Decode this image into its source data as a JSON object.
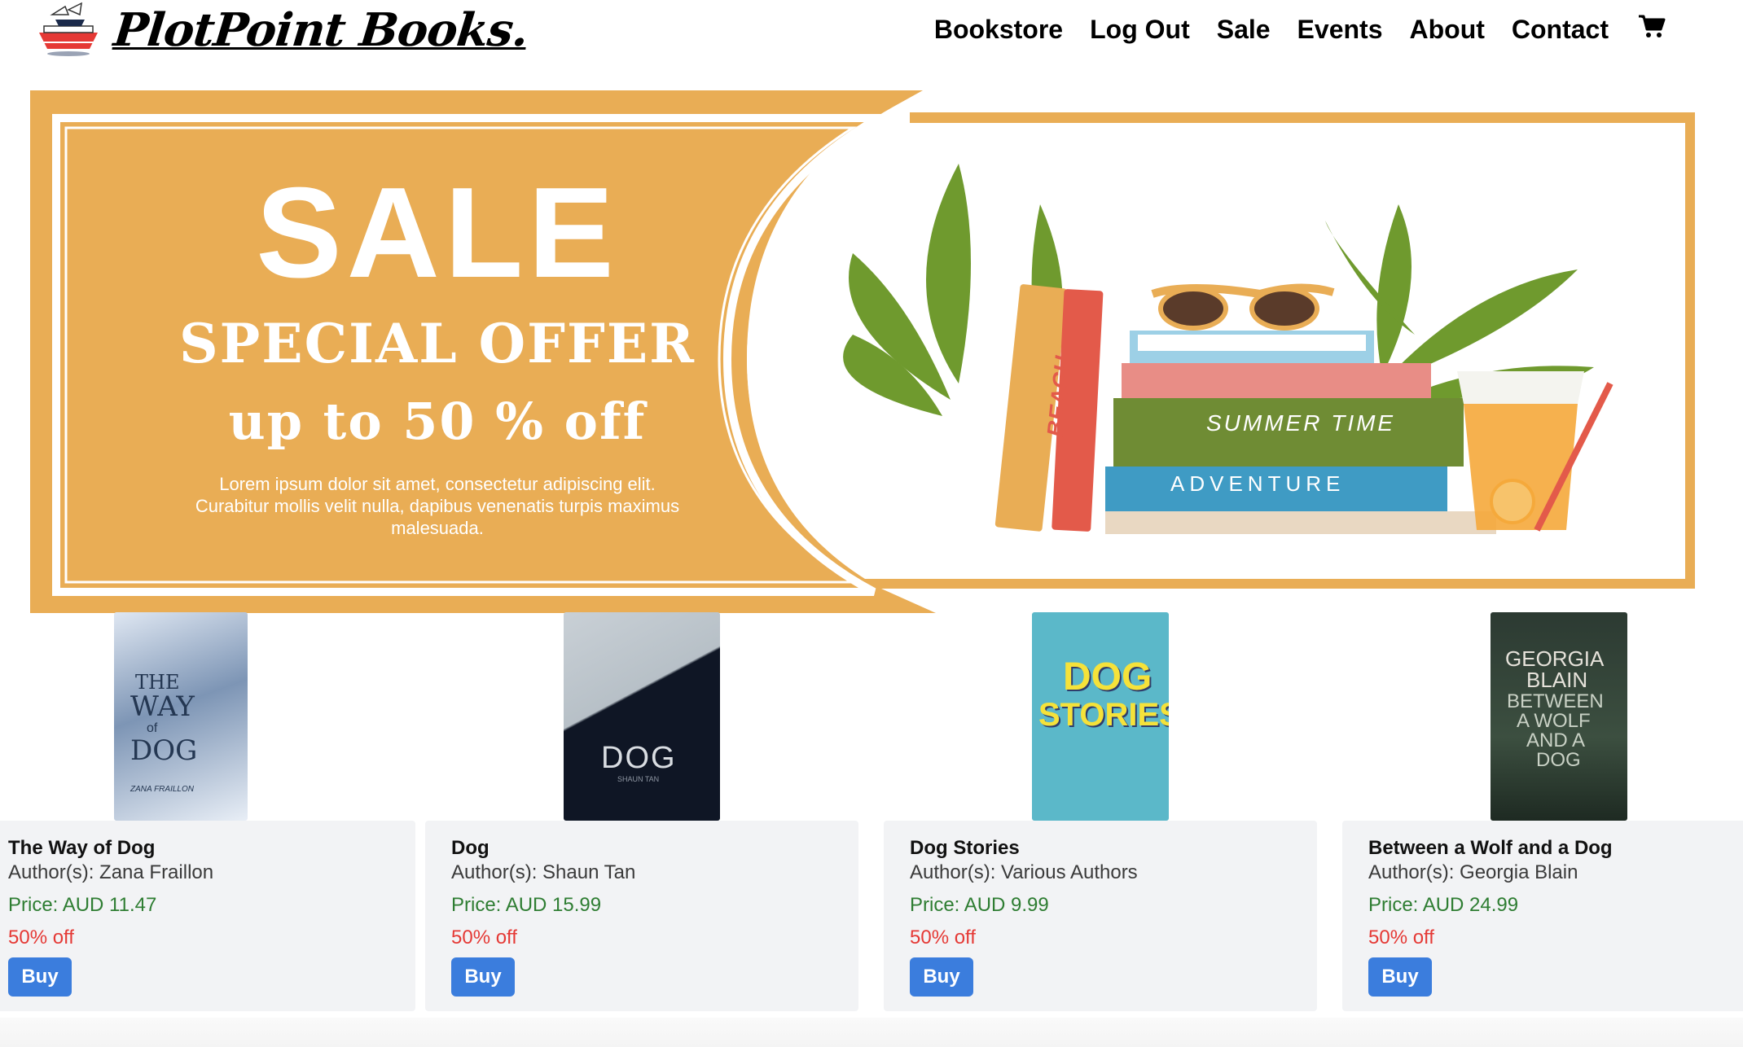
{
  "header": {
    "brand": "PlotPoint Books.",
    "nav": [
      "Bookstore",
      "Log Out",
      "Sale",
      "Events",
      "About",
      "Contact"
    ],
    "cart_icon": "shopping-cart-icon"
  },
  "banner": {
    "headline": "SALE",
    "subheadline": "SPECIAL OFFER",
    "discount": "up to 50 % off",
    "body": "Lorem ipsum dolor sit amet, consectetur adipiscing elit. Curabitur mollis velit nulla, dapibus venenatis turpis maximus malesuada.",
    "book_spines": [
      "BEACH",
      "SUMMER TIME",
      "ADVENTURE"
    ],
    "colors": {
      "accent": "#e9ad55",
      "background": "#ffffff"
    }
  },
  "products": [
    {
      "title": "The Way of Dog",
      "author": "Author(s): Zana Fraillon",
      "price": "Price: AUD 11.47",
      "discount": "50% off",
      "button": "Buy",
      "cover_text": [
        "THE",
        "WAY",
        "of",
        "DOG",
        "ZANA FRAILLON"
      ]
    },
    {
      "title": "Dog",
      "author": "Author(s): Shaun Tan",
      "price": "Price: AUD 15.99",
      "discount": "50% off",
      "button": "Buy",
      "cover_text": [
        "DOG",
        "SHAUN TAN"
      ]
    },
    {
      "title": "Dog Stories",
      "author": "Author(s): Various Authors",
      "price": "Price: AUD 9.99",
      "discount": "50% off",
      "button": "Buy",
      "cover_text": [
        "DOG",
        "STORIES"
      ]
    },
    {
      "title": "Between a Wolf and a Dog",
      "author": "Author(s): Georgia Blain",
      "price": "Price: AUD 24.99",
      "discount": "50% off",
      "button": "Buy",
      "cover_text": [
        "GEORGIA",
        "BLAIN",
        "BETWEEN",
        "A WOLF",
        "AND A",
        "DOG"
      ]
    }
  ],
  "colors": {
    "price": "#2e7d32",
    "discount": "#e53935",
    "button": "#3b7ddd",
    "card_bg": "#f2f3f5"
  }
}
